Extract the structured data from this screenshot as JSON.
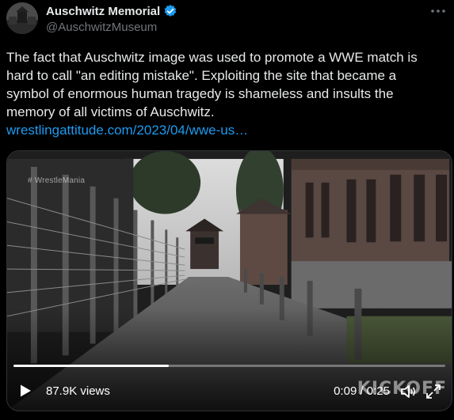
{
  "account": {
    "name": "Auschwitz Memorial",
    "handle": "@AuschwitzMuseum",
    "verified_color": "#1d9bf0"
  },
  "tweet": {
    "text": "The fact that Auschwitz image was used to promote a WWE match is hard to call \"an editing mistake\". Exploiting the site that became a symbol of enormous human tragedy is shameless and insults the memory of all victims of Auschwitz.",
    "link": "wrestlingattitude.com/2023/04/wwe-us…"
  },
  "video": {
    "watermark": "# WrestleMania",
    "views": "87.9K views",
    "time": "0:09 / 0:25",
    "progress": 0.36,
    "overlay_brand": "KICKOFF"
  },
  "icons": {
    "more": "more-icon",
    "play": "play-icon",
    "volume": "volume-icon",
    "fullscreen": "fullscreen-icon",
    "verified": "verified-badge-icon"
  }
}
